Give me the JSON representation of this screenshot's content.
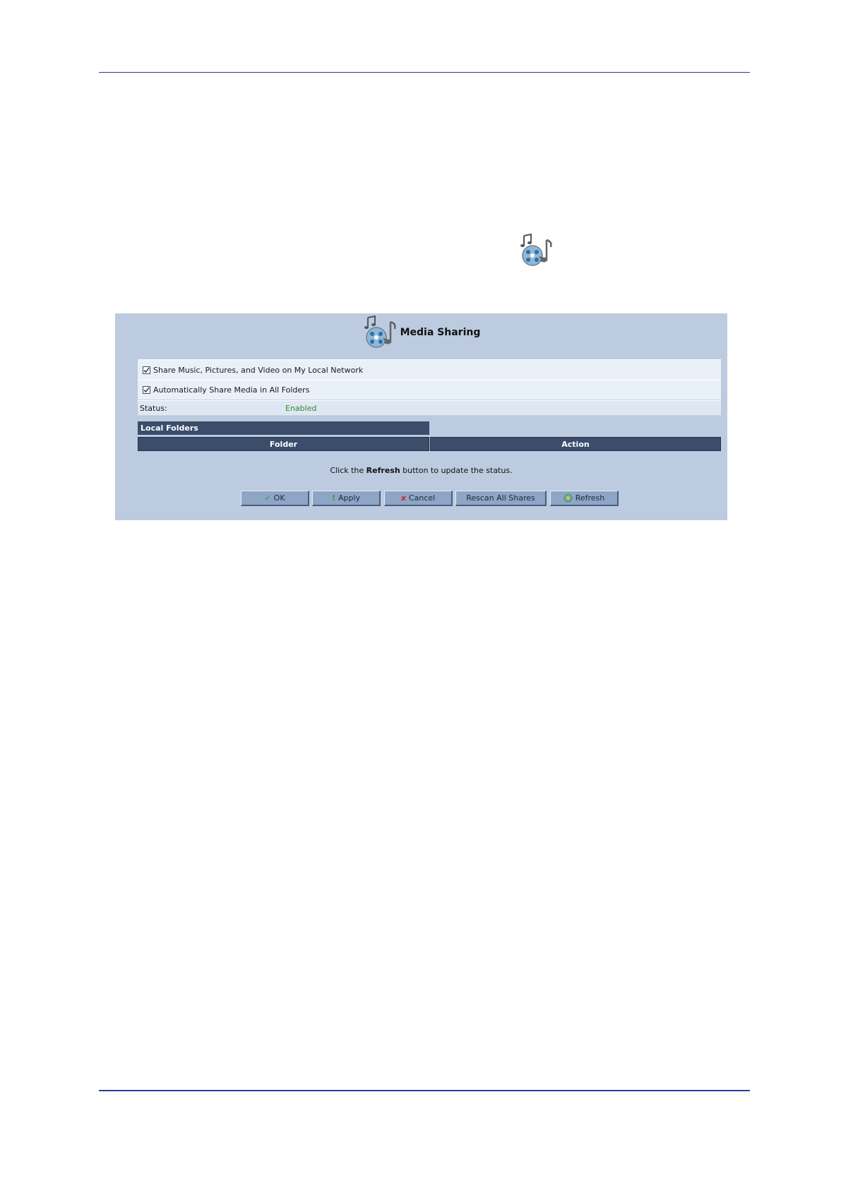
{
  "panel": {
    "title": "Media Sharing",
    "options": [
      {
        "label": "Share Music, Pictures, and Video on My Local Network",
        "checked": true
      },
      {
        "label": "Automatically Share Media in All Folders",
        "checked": true
      }
    ],
    "status": {
      "label": "Status:",
      "value": "Enabled",
      "value_color": "#2e8b2e"
    },
    "local_folders": {
      "title": "Local Folders",
      "columns": [
        "Folder",
        "Action"
      ]
    },
    "hint": {
      "prefix": "Click the ",
      "bold": "Refresh",
      "suffix": " button to update the status."
    },
    "buttons": {
      "ok": "OK",
      "apply": "Apply",
      "cancel": "Cancel",
      "rescan": "Rescan All Shares",
      "refresh": "Refresh"
    }
  },
  "icons": {
    "page_icon": "media-sharing-icon",
    "header_icon": "media-sharing-icon",
    "ok": "check-icon",
    "apply": "exclamation-icon",
    "cancel": "x-icon",
    "refresh": "refresh-icon"
  },
  "colors": {
    "panel_bg": "#bccbdf",
    "header_bar": "#3b4d6b",
    "rule": "#2b3a9a"
  }
}
